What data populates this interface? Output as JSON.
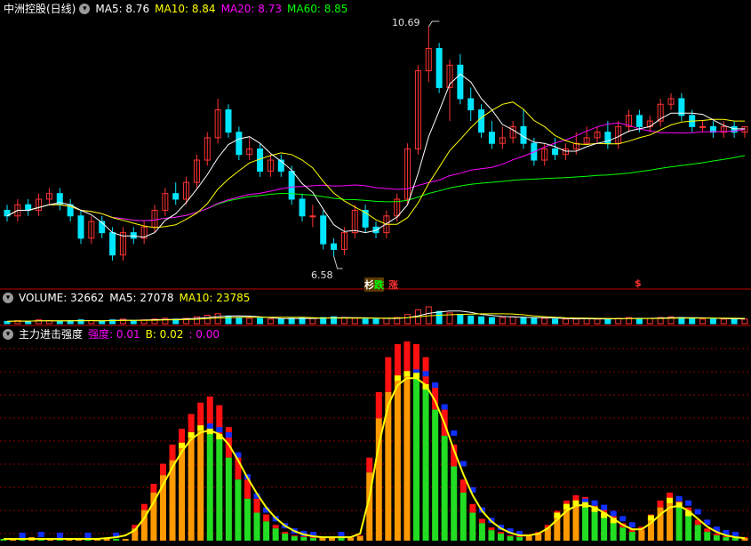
{
  "main_panel": {
    "title": "中洲控股(日线)",
    "collapse_icon": "chevron-down-icon",
    "ma_items": [
      {
        "label": "MA5: 8.76",
        "color": "#ffffff"
      },
      {
        "label": "MA10: 8.84",
        "color": "#ffff00"
      },
      {
        "label": "MA20: 8.73",
        "color": "#ff00ff"
      },
      {
        "label": "MA60: 8.85",
        "color": "#00ff00"
      }
    ],
    "high_label": "10.69",
    "low_label": "6.58",
    "tags": [
      {
        "text": "杉",
        "color": "#ffffff"
      },
      {
        "text": "跌",
        "color": "#00ff00"
      },
      {
        "text": "涨",
        "color": "#ff3333"
      },
      {
        "text": "$",
        "color": "#ff3333"
      }
    ]
  },
  "volume_panel": {
    "items": [
      {
        "label": "VOLUME: 32662",
        "color": "#ffffff"
      },
      {
        "label": "MA5: 27078",
        "color": "#ffffff"
      },
      {
        "label": "MA10: 23785",
        "color": "#ffff00"
      }
    ]
  },
  "indicator_panel": {
    "title": "主力进击强度",
    "items": [
      {
        "label": "强度: 0.01",
        "color": "#ff00ff"
      },
      {
        "label": "B: 0.02",
        "color": "#ffff00"
      },
      {
        "label": ": 0.00",
        "color": "#ff00ff"
      }
    ]
  },
  "colors": {
    "up": "#ff3333",
    "down": "#00e5ff",
    "grid": "#8b0000",
    "divider": "#c00000"
  },
  "chart_data": {
    "type": "candlestick",
    "price_range": [
      6.58,
      10.69
    ],
    "candles": [
      [
        7.4,
        7.3,
        7.5,
        7.2
      ],
      [
        7.3,
        7.5,
        7.6,
        7.2
      ],
      [
        7.5,
        7.4,
        7.6,
        7.3
      ],
      [
        7.4,
        7.6,
        7.7,
        7.3
      ],
      [
        7.6,
        7.7,
        7.8,
        7.5
      ],
      [
        7.7,
        7.5,
        7.8,
        7.4
      ],
      [
        7.5,
        7.3,
        7.6,
        7.2
      ],
      [
        7.3,
        6.9,
        7.4,
        6.8
      ],
      [
        6.9,
        7.2,
        7.3,
        6.8
      ],
      [
        7.2,
        7.0,
        7.3,
        6.9
      ],
      [
        7.0,
        6.6,
        7.1,
        6.5
      ],
      [
        6.6,
        7.0,
        7.1,
        6.5
      ],
      [
        7.0,
        6.9,
        7.1,
        6.8
      ],
      [
        6.9,
        7.1,
        7.2,
        6.8
      ],
      [
        7.1,
        7.4,
        7.5,
        7.0
      ],
      [
        7.4,
        7.7,
        7.8,
        7.3
      ],
      [
        7.7,
        7.6,
        7.9,
        7.5
      ],
      [
        7.6,
        7.9,
        8.0,
        7.5
      ],
      [
        7.9,
        8.3,
        8.4,
        7.8
      ],
      [
        8.3,
        8.7,
        8.8,
        8.2
      ],
      [
        8.7,
        9.2,
        9.4,
        8.6
      ],
      [
        9.2,
        8.8,
        9.3,
        8.7
      ],
      [
        8.8,
        8.4,
        8.9,
        8.3
      ],
      [
        8.4,
        8.5,
        8.7,
        8.3
      ],
      [
        8.5,
        8.1,
        8.6,
        8.0
      ],
      [
        8.1,
        8.3,
        8.4,
        8.0
      ],
      [
        8.3,
        8.1,
        8.4,
        8.0
      ],
      [
        8.1,
        7.6,
        8.2,
        7.5
      ],
      [
        7.6,
        7.3,
        7.7,
        7.2
      ],
      [
        7.3,
        7.3,
        7.5,
        7.1
      ],
      [
        7.3,
        6.8,
        7.4,
        6.7
      ],
      [
        6.8,
        6.7,
        6.9,
        6.58
      ],
      [
        6.7,
        7.0,
        7.1,
        6.6
      ],
      [
        7.0,
        7.4,
        7.5,
        6.9
      ],
      [
        7.4,
        7.1,
        7.5,
        7.0
      ],
      [
        7.1,
        7.0,
        7.2,
        6.9
      ],
      [
        7.0,
        7.3,
        7.4,
        6.9
      ],
      [
        7.3,
        7.6,
        7.7,
        7.2
      ],
      [
        7.6,
        8.5,
        8.6,
        7.5
      ],
      [
        8.5,
        9.9,
        10.0,
        8.4
      ],
      [
        9.9,
        10.3,
        10.69,
        9.7
      ],
      [
        10.3,
        9.6,
        10.4,
        9.5
      ],
      [
        9.6,
        10.0,
        10.1,
        9.0
      ],
      [
        10.0,
        9.4,
        10.2,
        9.3
      ],
      [
        9.4,
        9.2,
        9.6,
        9.0
      ],
      [
        9.2,
        8.8,
        9.3,
        8.7
      ],
      [
        8.8,
        8.6,
        9.0,
        8.5
      ],
      [
        8.6,
        8.7,
        8.9,
        8.5
      ],
      [
        8.7,
        8.9,
        9.0,
        8.6
      ],
      [
        8.9,
        8.6,
        9.2,
        8.5
      ],
      [
        8.6,
        8.3,
        8.7,
        8.2
      ],
      [
        8.3,
        8.5,
        8.6,
        8.2
      ],
      [
        8.5,
        8.4,
        8.7,
        8.3
      ],
      [
        8.4,
        8.5,
        8.6,
        8.3
      ],
      [
        8.5,
        8.6,
        8.8,
        8.4
      ],
      [
        8.6,
        8.7,
        8.9,
        8.6
      ],
      [
        8.7,
        8.8,
        8.9,
        8.6
      ],
      [
        8.8,
        8.6,
        9.0,
        8.5
      ],
      [
        8.6,
        8.9,
        9.0,
        8.5
      ],
      [
        8.9,
        9.1,
        9.2,
        8.8
      ],
      [
        9.1,
        8.9,
        9.2,
        8.8
      ],
      [
        8.9,
        9.0,
        9.1,
        8.8
      ],
      [
        9.0,
        9.3,
        9.4,
        8.9
      ],
      [
        9.3,
        9.4,
        9.5,
        9.2
      ],
      [
        9.4,
        9.1,
        9.5,
        9.0
      ],
      [
        9.1,
        8.9,
        9.2,
        8.8
      ],
      [
        8.9,
        8.9,
        9.0,
        8.8
      ],
      [
        8.9,
        8.8,
        9.0,
        8.7
      ],
      [
        8.8,
        8.9,
        9.0,
        8.7
      ],
      [
        8.9,
        8.8,
        9.0,
        8.7
      ],
      [
        8.8,
        8.9,
        8.9,
        8.7
      ]
    ],
    "volume": [
      3,
      4,
      3,
      5,
      4,
      3,
      4,
      5,
      4,
      3,
      5,
      6,
      4,
      5,
      6,
      7,
      6,
      7,
      9,
      11,
      13,
      10,
      8,
      7,
      7,
      6,
      6,
      7,
      8,
      7,
      8,
      9,
      8,
      7,
      6,
      6,
      7,
      8,
      12,
      18,
      22,
      16,
      14,
      12,
      10,
      9,
      8,
      8,
      9,
      8,
      7,
      7,
      6,
      6,
      6,
      7,
      6,
      6,
      7,
      8,
      7,
      7,
      8,
      9,
      8,
      7,
      6,
      6,
      6,
      7,
      6
    ],
    "strength": [
      2,
      3,
      2,
      4,
      2,
      3,
      2,
      2,
      3,
      2,
      2,
      3,
      2,
      2,
      14,
      35,
      55,
      75,
      92,
      108,
      120,
      128,
      124,
      118,
      95,
      70,
      48,
      32,
      22,
      14,
      8,
      5,
      4,
      3,
      3,
      4,
      3,
      3,
      5,
      78,
      140,
      170,
      185,
      190,
      188,
      175,
      150,
      120,
      85,
      55,
      32,
      20,
      12,
      8,
      5,
      4,
      5,
      8,
      15,
      28,
      38,
      42,
      40,
      35,
      28,
      22,
      15,
      10,
      12,
      25,
      38,
      45,
      40,
      30,
      18,
      10,
      6,
      4,
      3,
      3
    ],
    "strength_red": [
      0,
      0,
      0,
      0,
      0,
      0,
      0,
      0,
      0,
      0,
      0,
      0,
      0,
      0,
      18,
      42,
      65,
      88,
      110,
      128,
      145,
      158,
      165,
      155,
      130,
      100,
      70,
      48,
      30,
      18,
      10,
      6,
      5,
      4,
      4,
      4,
      4,
      4,
      6,
      95,
      170,
      210,
      225,
      228,
      225,
      210,
      180,
      150,
      110,
      70,
      42,
      25,
      15,
      10,
      6,
      5,
      6,
      10,
      18,
      34,
      46,
      52,
      50,
      44,
      36,
      28,
      20,
      14,
      16,
      30,
      46,
      55,
      50,
      38,
      24,
      14,
      8,
      5,
      4,
      4
    ],
    "strength_line": [
      2,
      2,
      2,
      2,
      2,
      2,
      2,
      2,
      2,
      2,
      2,
      3,
      4,
      6,
      12,
      26,
      44,
      64,
      84,
      102,
      116,
      124,
      126,
      122,
      110,
      92,
      72,
      54,
      38,
      26,
      17,
      11,
      7,
      5,
      4,
      4,
      4,
      4,
      8,
      50,
      110,
      155,
      178,
      186,
      186,
      178,
      160,
      134,
      104,
      76,
      52,
      34,
      22,
      14,
      9,
      6,
      6,
      8,
      14,
      24,
      34,
      40,
      41,
      38,
      32,
      25,
      18,
      13,
      13,
      20,
      30,
      38,
      40,
      34,
      25,
      16,
      10,
      6,
      4,
      3
    ]
  }
}
